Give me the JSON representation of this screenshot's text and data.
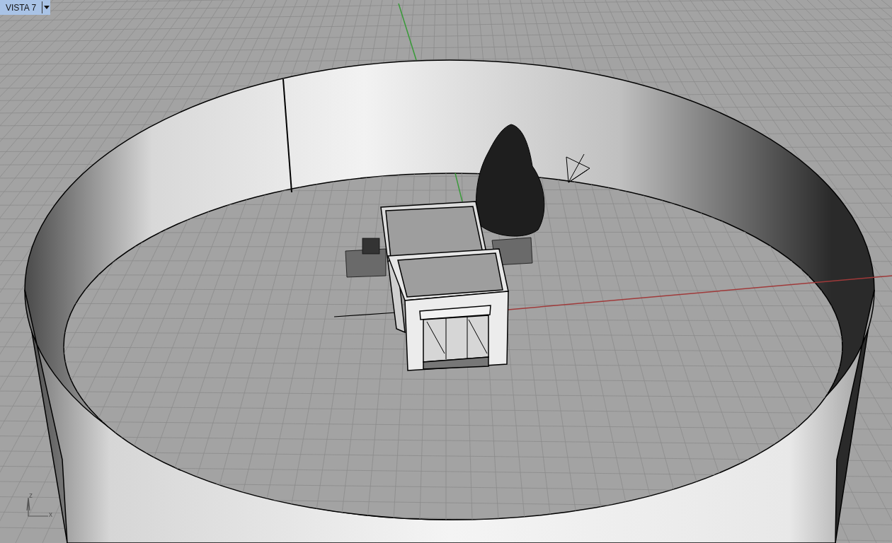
{
  "viewport": {
    "tab": {
      "label": "VISTA 7"
    },
    "axis_widget": {
      "z_label": "z",
      "x_label": "x"
    }
  }
}
